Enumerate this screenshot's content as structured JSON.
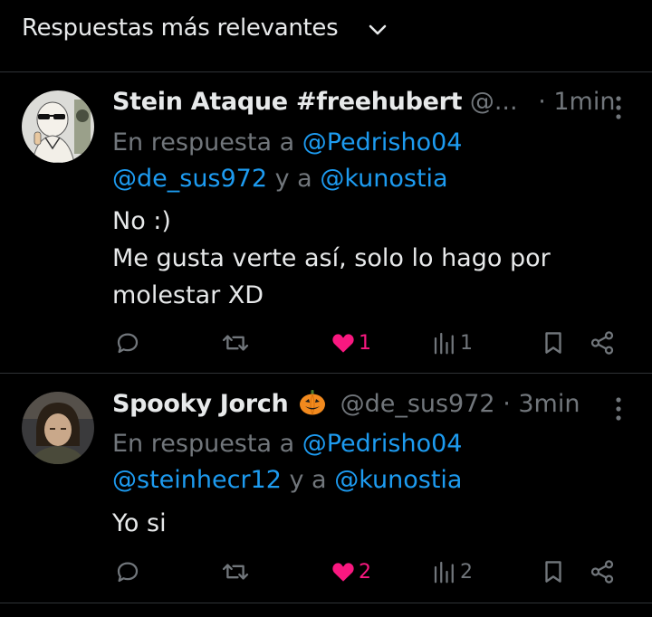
{
  "sort": {
    "label": "Respuestas más relevantes"
  },
  "tweets": [
    {
      "display_name": "Stein Ataque #freehubert",
      "handle": "@...",
      "separator": "·",
      "time": "1min",
      "reply_prefix": "En respuesta a",
      "mention_1": "@Pedrisho04",
      "mention_2": "@de_sus972",
      "reply_connector": "y a",
      "mention_3": "@kunostia",
      "text_line_1": "No :)",
      "text_line_2": "Me gusta verte así, solo lo hago por",
      "text_line_3": "molestar XD",
      "likes": "1",
      "views": "1",
      "liked": true
    },
    {
      "display_name": "Spooky Jorch",
      "emoji": "pumpkin-icon",
      "handle": "@de_sus972",
      "separator": "·",
      "time": "3min",
      "reply_prefix": "En respuesta a",
      "mention_1": "@Pedrisho04",
      "mention_2": "@steinhecr12",
      "reply_connector": "y a",
      "mention_3": "@kunostia",
      "text_line_1": "Yo si",
      "likes": "2",
      "views": "2",
      "liked": true
    }
  ],
  "colors": {
    "background": "#000000",
    "text": "#e7e9ea",
    "muted": "#71767b",
    "link": "#1d9bf0",
    "like": "#f91880",
    "divider": "#2f3336"
  }
}
